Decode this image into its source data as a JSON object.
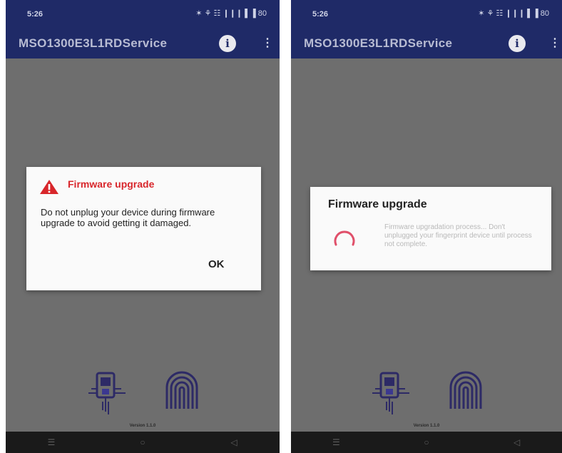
{
  "left": {
    "status": {
      "time": "5:26",
      "icons": "✶ ⚘ ☷ ❙❙❙ ▌▐ 80"
    },
    "appbar": {
      "title": "MSO1300E3L1RDService",
      "info_icon": "info-icon",
      "menu_icon": "overflow-menu-icon"
    },
    "dialog": {
      "icon": "warning-icon",
      "title": "Firmware upgrade",
      "message": "Do not unplug your device during firmware upgrade to avoid getting it damaged.",
      "ok_label": "OK"
    },
    "version": "Version 1.1.0",
    "nav": {
      "recents": "☰",
      "home": "○",
      "back": "◁"
    }
  },
  "right": {
    "status": {
      "time": "5:26",
      "icons": "✶ ⚘ ☷ ❙❙❙ ▌▐ 80"
    },
    "appbar": {
      "title": "MSO1300E3L1RDService",
      "info_icon": "info-icon",
      "menu_icon": "overflow-menu-icon"
    },
    "dialog": {
      "title": "Firmware upgrade",
      "message": "Firmware upgradation process... Don't unplugged your fingerprint device until process not complete.",
      "spinner_color": "#e0506a"
    },
    "version": "Version 1.1.0",
    "nav": {
      "recents": "☰",
      "home": "○",
      "back": "◁"
    }
  },
  "colors": {
    "appbar": "#1f2a67",
    "scrim": "#6e6e6e",
    "warning_red": "#d8262b",
    "spinner_pink": "#e0506a",
    "device_icon": "#2d2a66"
  }
}
